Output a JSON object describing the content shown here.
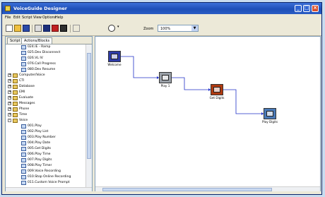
{
  "window": {
    "title": "VoiceGuide Designer"
  },
  "menu": [
    "File",
    "Edit",
    "Script",
    "View",
    "Options",
    "Help"
  ],
  "toolbar": {
    "icons": [
      "new-icon",
      "open-icon",
      "save-icon",
      "print-icon",
      "cut-icon",
      "copy-icon",
      "paste-icon",
      "run-icon",
      "find-icon",
      "zoom-icon"
    ],
    "zoom_label": "Zoom",
    "zoom_value": "100%"
  },
  "tabs": [
    "Script",
    "Actions/Blocks"
  ],
  "tree": [
    {
      "label": "024.IE - Ramp",
      "indent": 2,
      "expander": ""
    },
    {
      "label": "025.Dev Disconnect",
      "indent": 2,
      "expander": ""
    },
    {
      "label": "026.VL IV",
      "indent": 2,
      "expander": ""
    },
    {
      "label": "076.Call Progress",
      "indent": 2,
      "expander": ""
    },
    {
      "label": "080.Dev Resume",
      "indent": 2,
      "expander": ""
    },
    {
      "label": "Computer/Voice",
      "indent": 0,
      "expander": "+"
    },
    {
      "label": "CTI",
      "indent": 0,
      "expander": "+"
    },
    {
      "label": "Database",
      "indent": 0,
      "expander": "+"
    },
    {
      "label": "EMI",
      "indent": 0,
      "expander": "+"
    },
    {
      "label": "Evaluate",
      "indent": 0,
      "expander": "+"
    },
    {
      "label": "Messages",
      "indent": 0,
      "expander": "+"
    },
    {
      "label": "Phone",
      "indent": 0,
      "expander": "+"
    },
    {
      "label": "Time",
      "indent": 0,
      "expander": "+"
    },
    {
      "label": "Voice",
      "indent": 0,
      "expander": "-"
    },
    {
      "label": "001.Play",
      "indent": 2,
      "expander": ""
    },
    {
      "label": "002.Play List",
      "indent": 2,
      "expander": ""
    },
    {
      "label": "003.Play Number",
      "indent": 2,
      "expander": ""
    },
    {
      "label": "004.Play Date",
      "indent": 2,
      "expander": ""
    },
    {
      "label": "005.Get Digits",
      "indent": 2,
      "expander": ""
    },
    {
      "label": "006.Play Time",
      "indent": 2,
      "expander": ""
    },
    {
      "label": "007.Play Digits",
      "indent": 2,
      "expander": ""
    },
    {
      "label": "008.Play Timer",
      "indent": 2,
      "expander": ""
    },
    {
      "label": "009.Voice Recording",
      "indent": 2,
      "expander": ""
    },
    {
      "label": "010.Stop Online Recording",
      "indent": 2,
      "expander": ""
    },
    {
      "label": "011.Custom Voice Prompt",
      "indent": 2,
      "expander": ""
    }
  ],
  "nodes": [
    {
      "id": "start",
      "label": "Welcome",
      "icon": "phone-block-icon",
      "color": "#2d3ba8"
    },
    {
      "id": "step2",
      "label": "Play 1",
      "icon": "play-block-icon",
      "color": "#9aa0a8"
    },
    {
      "id": "step3",
      "label": "Get Digits",
      "icon": "digits-block-icon",
      "color": "#b03a10"
    },
    {
      "id": "step4",
      "label": "Play Digits",
      "icon": "play-digits-block-icon",
      "color": "#4a7ab8"
    }
  ]
}
